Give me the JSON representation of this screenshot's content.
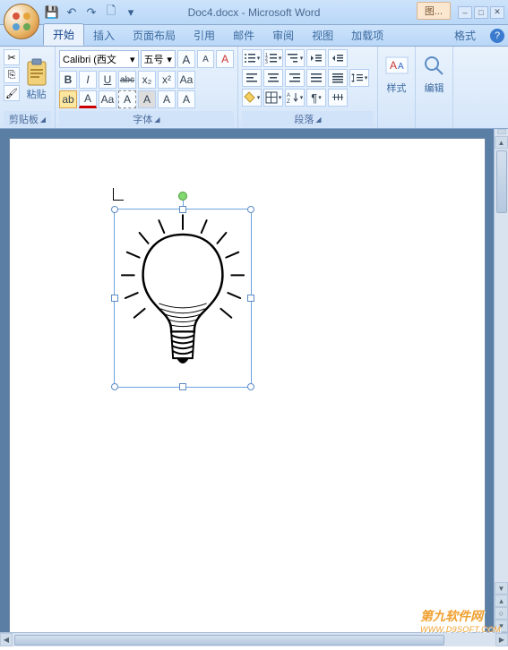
{
  "title": "Doc4.docx - Microsoft Word",
  "context_tab": "图...",
  "qat": {
    "save": "💾",
    "undo": "↶",
    "redo": "↷",
    "new": "🗋"
  },
  "win": {
    "min": "–",
    "max": "□",
    "close": "✕"
  },
  "tabs": [
    "开始",
    "插入",
    "页面布局",
    "引用",
    "邮件",
    "审阅",
    "视图",
    "加载项"
  ],
  "format_tab": "格式",
  "help": "?",
  "clipboard": {
    "label": "剪贴板",
    "paste": "粘贴",
    "cut": "✂",
    "copy": "⎘",
    "fmt": "🖌"
  },
  "font": {
    "label": "字体",
    "name": "Calibri (西文",
    "size": "五号",
    "growshrink": [
      "A",
      "A"
    ],
    "clear": "A",
    "row2": {
      "bold": "B",
      "italic": "I",
      "underline": "U",
      "strike": "abc",
      "sub": "x₂",
      "sup": "x²",
      "case": "Aa"
    },
    "row3": {
      "highlight": "ab",
      "color": "A",
      "changecase": "Aa",
      "charborder": "A",
      "charshade": "A",
      "grow": "A",
      "shrink": "A"
    }
  },
  "para": {
    "label": "段落"
  },
  "styles": {
    "label": "样式"
  },
  "edit": {
    "label": "编辑"
  },
  "watermark": {
    "line1": "第九软件网",
    "line2": "WWW.D9SOFT.COM"
  }
}
